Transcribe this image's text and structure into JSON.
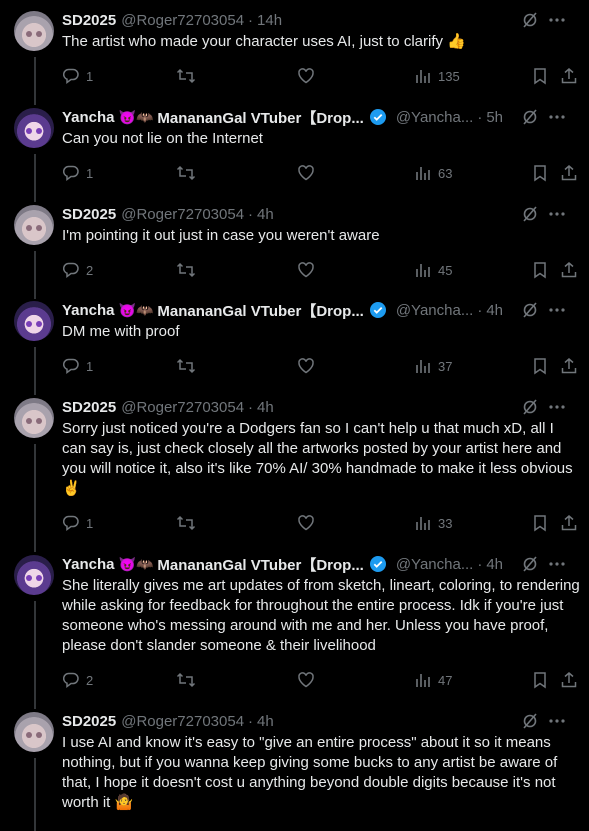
{
  "tweets": [
    {
      "name": "SD2025",
      "handle": "@Roger72703054",
      "time": "14h",
      "text": "The artist who made your character uses AI, just to clarify 👍",
      "replies": "1",
      "likes": "",
      "views": "135",
      "avatar": "sd"
    },
    {
      "name": "Yancha",
      "emojis": "😈🦇",
      "name2": "ManananGal VTuber【Drop...",
      "handle": "@Yancha...",
      "time": "5h",
      "text": "Can you not lie on the Internet",
      "replies": "1",
      "likes": "",
      "views": "63",
      "avatar": "ya"
    },
    {
      "name": "SD2025",
      "handle": "@Roger72703054",
      "time": "4h",
      "text": "I'm pointing it out just in case you weren't aware",
      "replies": "2",
      "likes": "",
      "views": "45",
      "avatar": "sd"
    },
    {
      "name": "Yancha",
      "emojis": "😈🦇",
      "name2": "ManananGal VTuber【Drop...",
      "handle": "@Yancha...",
      "time": "4h",
      "text": "DM me with proof",
      "replies": "1",
      "likes": "",
      "views": "37",
      "avatar": "ya"
    },
    {
      "name": "SD2025",
      "handle": "@Roger72703054",
      "time": "4h",
      "text": "Sorry just noticed you're a Dodgers fan so I can't help u that much xD, all I can say is, just check closely all the artworks posted by your artist here and you will notice it, also it's like 70% AI/ 30% handmade to make it less obvious ✌️",
      "replies": "1",
      "likes": "",
      "views": "33",
      "avatar": "sd"
    },
    {
      "name": "Yancha",
      "emojis": "😈🦇",
      "name2": "ManananGal VTuber【Drop...",
      "handle": "@Yancha...",
      "time": "4h",
      "text": "She literally gives me art updates of from sketch, lineart, coloring, to rendering while asking for feedback for throughout the entire process. Idk if you're just someone who's messing around with me and her. Unless you have proof, please don't slander someone & their livelihood",
      "replies": "2",
      "likes": "",
      "views": "47",
      "avatar": "ya"
    },
    {
      "name": "SD2025",
      "handle": "@Roger72703054",
      "time": "4h",
      "text": "I use AI and know it's easy to \"give an entire process\" about it so it means nothing, but if you wanna keep giving some bucks to any artist be aware of that, I hope it doesn't cost u anything beyond double digits because it's not worth it 🤷",
      "replies": "",
      "likes": "",
      "views": "",
      "avatar": "sd"
    }
  ],
  "icons": {
    "reply": "reply-icon",
    "retweet": "retweet-icon",
    "like": "heart-icon",
    "views": "views-icon",
    "bookmark": "bookmark-icon",
    "share": "share-icon",
    "grok": "grok-icon",
    "more": "more-icon",
    "verified": "verified-badge-icon"
  },
  "colors": {
    "background": "#000000",
    "text": "#e7e9ea",
    "muted": "#71767b",
    "verified": "#1d9bf0"
  }
}
